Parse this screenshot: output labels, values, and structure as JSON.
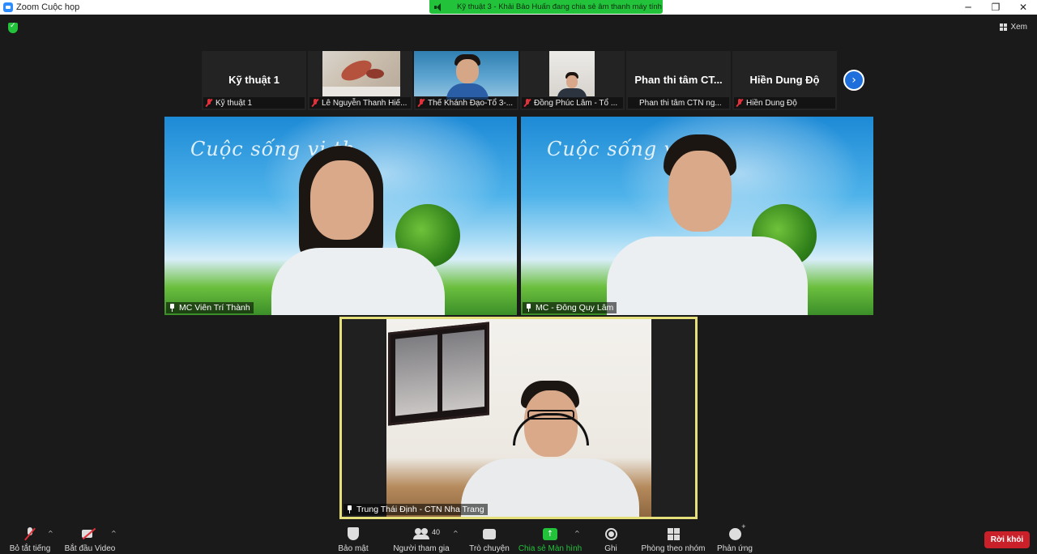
{
  "window": {
    "title": "Zoom Cuộc họp",
    "controls": [
      "─",
      "❐",
      "✕"
    ]
  },
  "share_banner": {
    "text": "Kỹ thuật 3 - Khải Bảo Huấn đang chia sẻ âm thanh máy tính"
  },
  "view_button": {
    "label": "Xem"
  },
  "thumbnails": [
    {
      "big_name": "Kỹ thuật 1",
      "label": "Kỹ thuật 1",
      "has_video": false
    },
    {
      "big_name": "",
      "label": "Lê Nguyễn Thanh Hiế...",
      "has_video": true
    },
    {
      "big_name": "",
      "label": "Thế Khánh Đạo-Tổ 3-...",
      "has_video": true
    },
    {
      "big_name": "",
      "label": "Đồng Phúc Lâm - Tổ ...",
      "has_video": true
    },
    {
      "big_name": "Phan thi tâm CT...",
      "label": "Phan thi tâm CTN ng...",
      "has_video": false
    },
    {
      "big_name": "Hiền Dung Độ",
      "label": "Hiền Dung Độ",
      "has_video": false
    }
  ],
  "main_tiles": {
    "left_name": "MC Viên Trí Thành",
    "right_name": "MC - Đông Quy Lâm",
    "bottom_name": "Trung Thái Định - CTN Nha Trang",
    "background_text": "Cuộc sống vị th"
  },
  "toolbar": {
    "mute_label": "Bỏ tắt tiếng",
    "video_label": "Bắt đầu Video",
    "security_label": "Bảo mật",
    "participants_label": "Người tham gia",
    "participants_count": "40",
    "chat_label": "Trò chuyện",
    "share_label": "Chia sẻ Màn hình",
    "record_label": "Ghi",
    "rooms_label": "Phòng theo nhóm",
    "reactions_label": "Phản ứng",
    "leave_label": "Rời khỏi"
  },
  "colors": {
    "accent_green": "#23c23b",
    "leave_red": "#c9202a",
    "active_speaker_border": "#e5e07c"
  }
}
